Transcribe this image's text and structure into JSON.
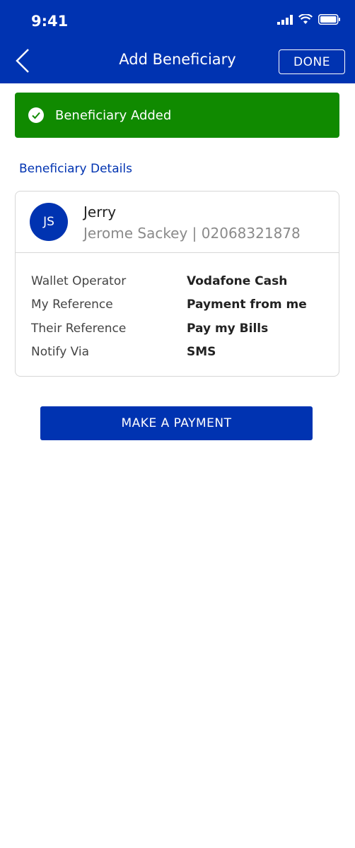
{
  "status_bar": {
    "time": "9:41"
  },
  "nav": {
    "title": "Add Beneficiary",
    "done_label": "DONE"
  },
  "banner": {
    "text": "Beneficiary Added",
    "color": "#108a00"
  },
  "section": {
    "title": "Beneficiary Details"
  },
  "beneficiary": {
    "initials": "JS",
    "nickname": "Jerry",
    "name_phone": "Jerome Sackey | 02068321878",
    "details": [
      {
        "label": "Wallet Operator",
        "value": "Vodafone Cash"
      },
      {
        "label": "My Reference",
        "value": "Payment from me"
      },
      {
        "label": "Their Reference",
        "value": "Pay my Bills"
      },
      {
        "label": "Notify Via",
        "value": "SMS"
      }
    ]
  },
  "actions": {
    "make_payment_label": "MAKE A PAYMENT"
  },
  "colors": {
    "brand": "#0033b1",
    "success": "#108a00"
  }
}
